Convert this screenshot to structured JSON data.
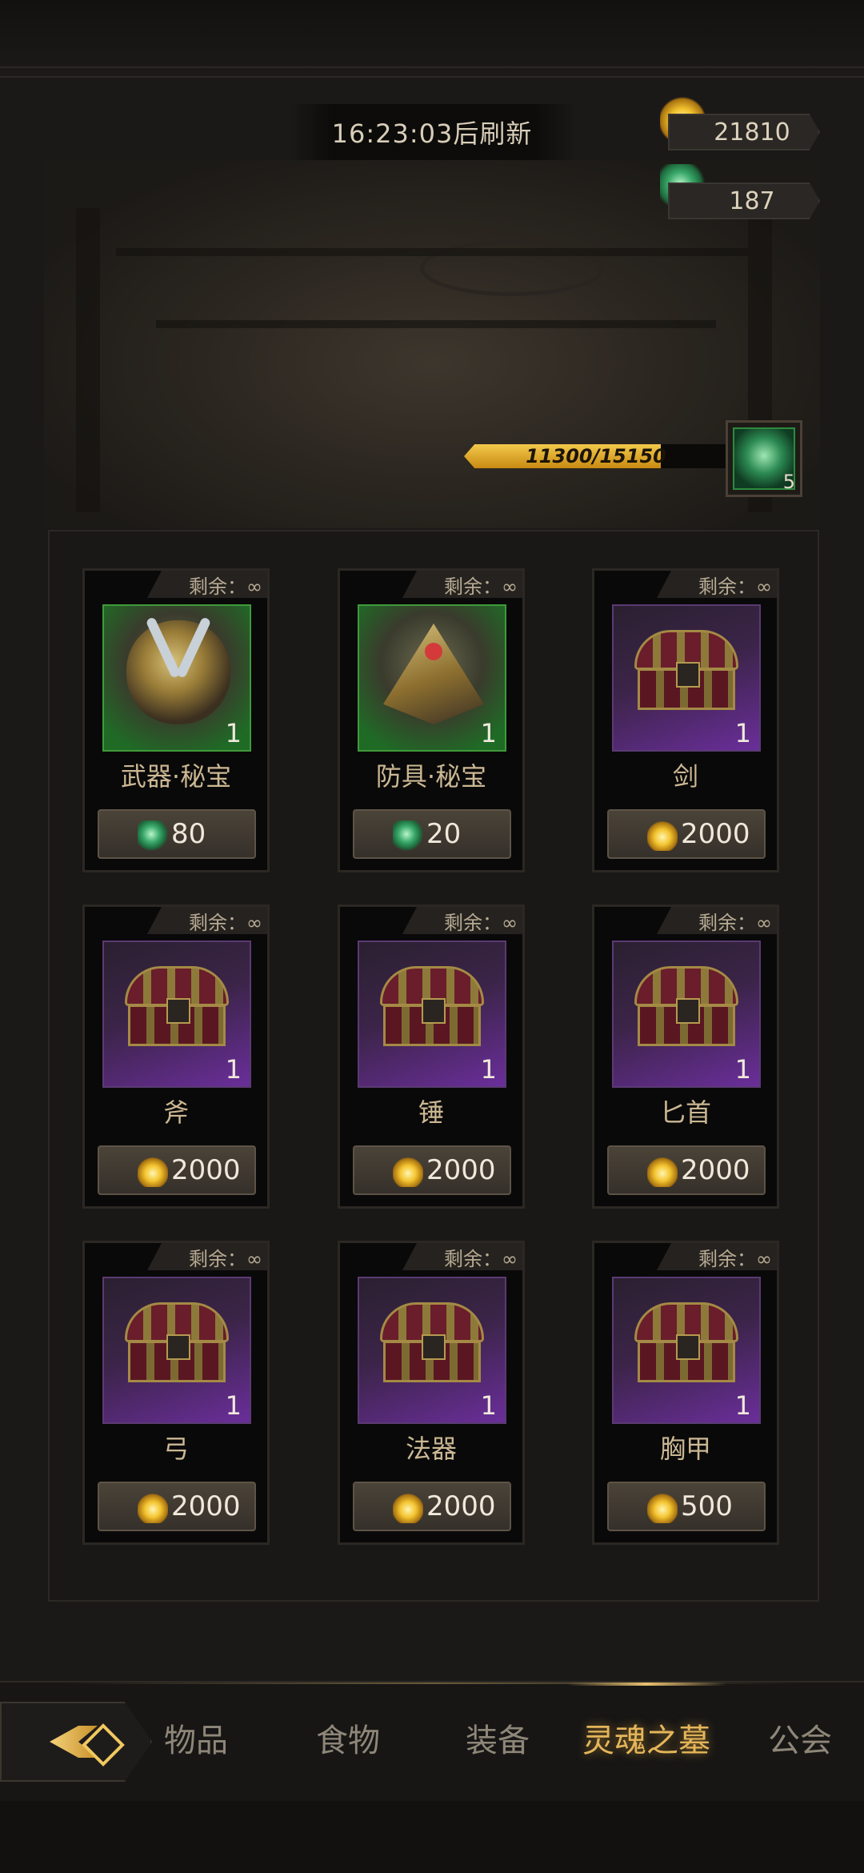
{
  "header": {
    "refresh_timer": "16:23:03后刷新"
  },
  "resources": {
    "gold": {
      "icon": "lantern-coin-icon",
      "value": "21810"
    },
    "crystal": {
      "icon": "green-crystal-icon",
      "value": "187"
    }
  },
  "progress": {
    "text": "11300/15150",
    "current": 11300,
    "max": 15150
  },
  "reward": {
    "icon": "green-crystal-icon",
    "count": "5"
  },
  "items": [
    {
      "remain": "剩余：∞",
      "name": "武器·秘宝",
      "qty": "1",
      "price": "80",
      "currency": "crystal",
      "frame": "green"
    },
    {
      "remain": "剩余：∞",
      "name": "防具·秘宝",
      "qty": "1",
      "price": "20",
      "currency": "crystal",
      "frame": "green"
    },
    {
      "remain": "剩余：∞",
      "name": "剑",
      "qty": "1",
      "price": "2000",
      "currency": "gold",
      "frame": "purple"
    },
    {
      "remain": "剩余：∞",
      "name": "斧",
      "qty": "1",
      "price": "2000",
      "currency": "gold",
      "frame": "purple"
    },
    {
      "remain": "剩余：∞",
      "name": "锤",
      "qty": "1",
      "price": "2000",
      "currency": "gold",
      "frame": "purple"
    },
    {
      "remain": "剩余：∞",
      "name": "匕首",
      "qty": "1",
      "price": "2000",
      "currency": "gold",
      "frame": "purple"
    },
    {
      "remain": "剩余：∞",
      "name": "弓",
      "qty": "1",
      "price": "2000",
      "currency": "gold",
      "frame": "purple"
    },
    {
      "remain": "剩余：∞",
      "name": "法器",
      "qty": "1",
      "price": "2000",
      "currency": "gold",
      "frame": "purple"
    },
    {
      "remain": "剩余：∞",
      "name": "胸甲",
      "qty": "1",
      "price": "500",
      "currency": "gold",
      "frame": "purple"
    }
  ],
  "nav": {
    "back_icon": "back-arrow-icon",
    "tabs": [
      {
        "label": "物品",
        "active": false
      },
      {
        "label": "食物",
        "active": false
      },
      {
        "label": "装备",
        "active": false
      },
      {
        "label": "灵魂之墓",
        "active": true
      },
      {
        "label": "公会",
        "active": false
      }
    ]
  },
  "colors": {
    "accent": "#e5b65a",
    "green_frame": "#3f9a3a",
    "purple_frame": "#6a2e9a",
    "progress_fill": "#f2c94c"
  }
}
